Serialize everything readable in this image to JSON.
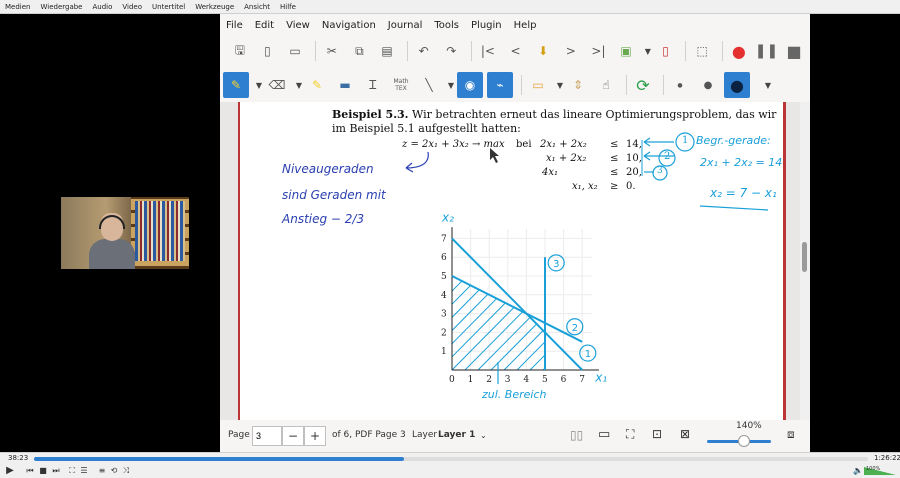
{
  "vlc": {
    "menu": [
      "Medien",
      "Wiedergabe",
      "Audio",
      "Video",
      "Untertitel",
      "Werkzeuge",
      "Ansicht",
      "Hilfe"
    ],
    "time_elapsed": "38:23",
    "time_total": "1:26:22",
    "progress": 0.444,
    "volume_label": "100%"
  },
  "xournal": {
    "menu": [
      "File",
      "Edit",
      "View",
      "Navigation",
      "Journal",
      "Tools",
      "Plugin",
      "Help"
    ],
    "tex_label_top": "Math",
    "tex_label_bottom": "TEX",
    "zoom_label": "140%",
    "page_label": "Page",
    "page_value": "3",
    "page_of": "of 6, PDF Page 3",
    "layer_label": "Layer",
    "layer_value": "Layer 1"
  },
  "document": {
    "heading_bold": "Beispiel 5.3.",
    "heading_rest": "Wir betrachten erneut das lineare Optimierungsproblem, das wir",
    "heading_line2": "im Beispiel 5.1 aufgestellt hatten:",
    "objective": "z = 2x₁ + 3x₂ → max",
    "bei": "bei",
    "constraints": [
      {
        "lhs": "2x₁ + 2x₂",
        "op": "≤",
        "rhs": "14,"
      },
      {
        "lhs": "x₁ + 2x₂",
        "op": "≤",
        "rhs": "10,"
      },
      {
        "lhs": "4x₁",
        "op": "≤",
        "rhs": "20,"
      },
      {
        "lhs": "x₁, x₂",
        "op": "≥",
        "rhs": "0."
      }
    ],
    "annotations": {
      "niveau1": "Niveaugeraden",
      "niveau2": "sind Geraden mit",
      "niveau3": "Anstieg  − 2/3",
      "begr": "Begr.-gerade:",
      "eq1": "2x₁ + 2x₂ = 14",
      "eq2": "x₂ = 7 − x₁",
      "zul": "zul. Bereich",
      "x2_axis": "x₂",
      "x1_axis": "x₁",
      "c1": "1",
      "c2": "2",
      "c3": "3"
    },
    "axis_ticks_x": [
      "0",
      "1",
      "2",
      "3",
      "4",
      "5",
      "6",
      "7"
    ],
    "axis_ticks_y": [
      "1",
      "2",
      "3",
      "4",
      "5",
      "6",
      "7"
    ]
  },
  "chart_data": {
    "type": "line",
    "xlim": [
      0,
      7
    ],
    "ylim": [
      0,
      7
    ],
    "series": [
      {
        "name": "1",
        "x": [
          0,
          7
        ],
        "y": [
          7,
          0
        ]
      },
      {
        "name": "2",
        "x": [
          0,
          7
        ],
        "y": [
          5,
          1.5
        ]
      },
      {
        "name": "3",
        "x": [
          5,
          5
        ],
        "y": [
          0,
          6
        ]
      }
    ],
    "colors": {
      "ink": "#1aa0d8",
      "blue_ink": "#2a3fb0",
      "axes": "#222"
    }
  }
}
